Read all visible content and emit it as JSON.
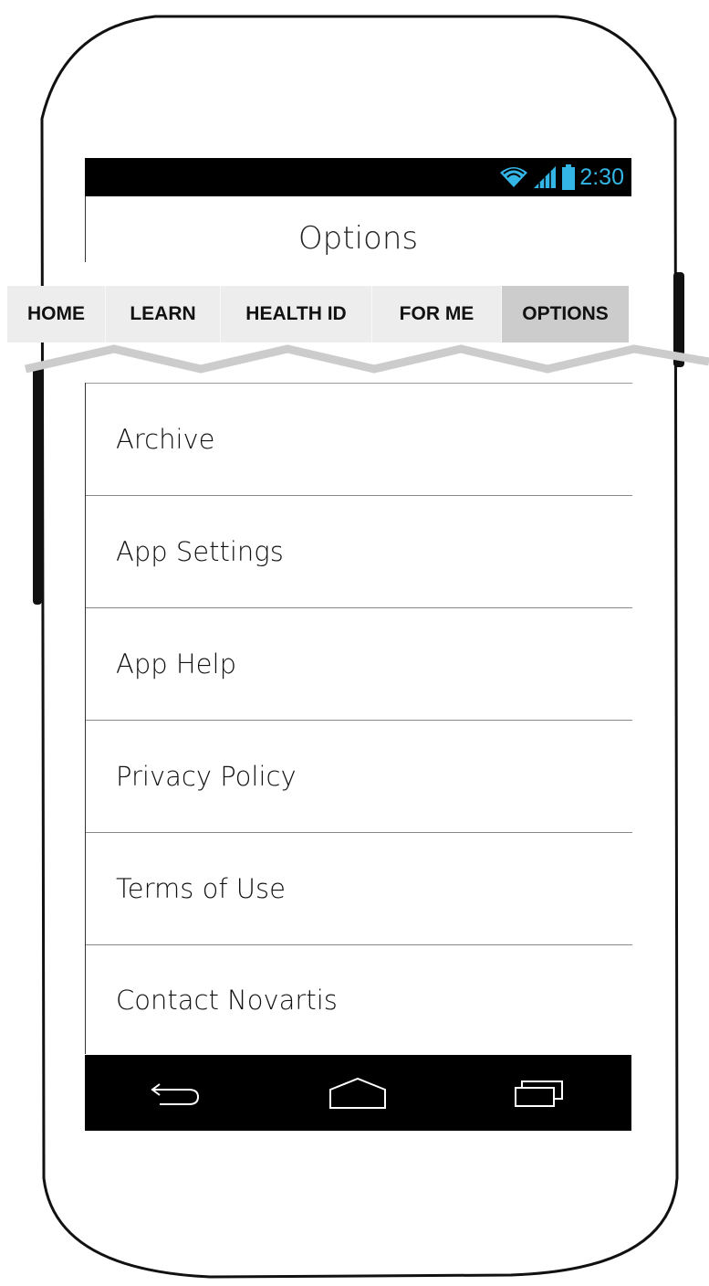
{
  "status_bar": {
    "time": "2:30",
    "wifi_icon": "wifi-icon",
    "signal_icon": "signal-icon",
    "battery_icon": "battery-icon",
    "accent_color": "#33b5e5"
  },
  "header": {
    "title": "Options"
  },
  "tabs": [
    {
      "label": "HOME",
      "active": false
    },
    {
      "label": "LEARN",
      "active": false
    },
    {
      "label": "HEALTH ID",
      "active": false
    },
    {
      "label": "FOR ME",
      "active": false
    },
    {
      "label": "OPTIONS",
      "active": true
    }
  ],
  "menu": {
    "items": [
      {
        "label": "Archive"
      },
      {
        "label": "App Settings"
      },
      {
        "label": "App Help"
      },
      {
        "label": "Privacy Policy"
      },
      {
        "label": "Terms of Use"
      },
      {
        "label": "Contact Novartis"
      }
    ]
  },
  "nav_bar": {
    "back_icon": "back-icon",
    "home_icon": "home-icon",
    "recents_icon": "recents-icon"
  }
}
